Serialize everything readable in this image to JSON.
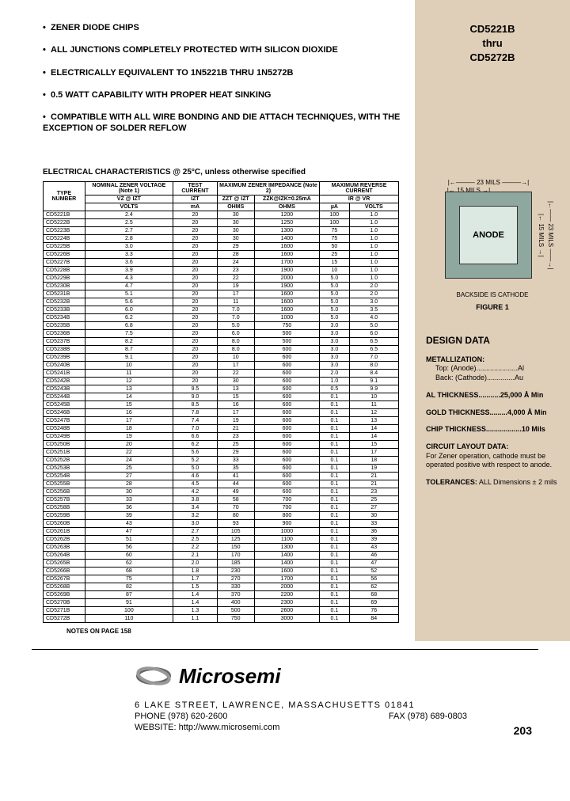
{
  "parts": {
    "top": "CD5221B",
    "mid": "thru",
    "bot": "CD5272B"
  },
  "bullets": [
    "ZENER DIODE CHIPS",
    "ALL JUNCTIONS COMPLETELY PROTECTED WITH SILICON DIOXIDE",
    "ELECTRICALLY EQUIVALENT TO 1N5221B THRU 1N5272B",
    "0.5 WATT CAPABILITY WITH PROPER HEAT SINKING",
    "COMPATIBLE WITH ALL WIRE BONDING AND DIE ATTACH TECHNIQUES, WITH THE EXCEPTION OF SOLDER REFLOW"
  ],
  "ec_title": "ELECTRICAL CHARACTERISTICS @ 25°C, unless otherwise specified",
  "headers": {
    "type": "TYPE NUMBER",
    "nominal": "NOMINAL ZENER VOLTAGE (Note 1)",
    "test": "TEST CURRENT",
    "maximp": "MAXIMUM ZENER IMPEDANCE (Note 2)",
    "maxrev": "MAXIMUM REVERSE CURRENT",
    "vz": "VZ @ IZT",
    "izt": "IZT",
    "zzt": "ZZT @ IZT",
    "zzk": "ZZK@IZK=0.25mA",
    "ir": "IR @ VR",
    "u_volts": "VOLTS",
    "u_ma": "mA",
    "u_ohms": "OHMS",
    "u_ua": "µA"
  },
  "notes_line": "NOTES ON PAGE 158",
  "chart_data": {
    "type": "table",
    "columns": [
      "TYPE",
      "VZ@IZT (V)",
      "IZT (mA)",
      "ZZT@IZT (Ω)",
      "ZZK@IZK=0.25mA (Ω)",
      "IR (µA)",
      "VR (V)"
    ],
    "rows": [
      [
        "CD5221B",
        "2.4",
        "20",
        "30",
        "1200",
        "100",
        "1.0"
      ],
      [
        "CD5222B",
        "2.5",
        "20",
        "30",
        "1250",
        "100",
        "1.0"
      ],
      [
        "CD5223B",
        "2.7",
        "20",
        "30",
        "1300",
        "75",
        "1.0"
      ],
      [
        "CD5224B",
        "2.8",
        "20",
        "30",
        "1400",
        "75",
        "1.0"
      ],
      [
        "CD5225B",
        "3.0",
        "20",
        "29",
        "1600",
        "50",
        "1.0"
      ],
      [
        "CD5226B",
        "3.3",
        "20",
        "28",
        "1600",
        "25",
        "1.0"
      ],
      [
        "CD5227B",
        "3.6",
        "20",
        "24",
        "1700",
        "15",
        "1.0"
      ],
      [
        "CD5228B",
        "3.9",
        "20",
        "23",
        "1900",
        "10",
        "1.0"
      ],
      [
        "CD5229B",
        "4.3",
        "20",
        "22",
        "2000",
        "5.0",
        "1.0"
      ],
      [
        "CD5230B",
        "4.7",
        "20",
        "19",
        "1900",
        "5.0",
        "2.0"
      ],
      [
        "CD5231B",
        "5.1",
        "20",
        "17",
        "1600",
        "5.0",
        "2.0"
      ],
      [
        "CD5232B",
        "5.6",
        "20",
        "11",
        "1600",
        "5.0",
        "3.0"
      ],
      [
        "CD5233B",
        "6.0",
        "20",
        "7.0",
        "1600",
        "5.0",
        "3.5"
      ],
      [
        "CD5234B",
        "6.2",
        "20",
        "7.0",
        "1000",
        "5.0",
        "4.0"
      ],
      [
        "CD5235B",
        "6.8",
        "20",
        "5.0",
        "750",
        "3.0",
        "5.0"
      ],
      [
        "CD5236B",
        "7.5",
        "20",
        "6.0",
        "500",
        "3.0",
        "6.0"
      ],
      [
        "CD5237B",
        "8.2",
        "20",
        "8.0",
        "500",
        "3.0",
        "6.5"
      ],
      [
        "CD5238B",
        "8.7",
        "20",
        "8.0",
        "600",
        "3.0",
        "6.5"
      ],
      [
        "CD5239B",
        "9.1",
        "20",
        "10",
        "600",
        "3.0",
        "7.0"
      ],
      [
        "CD5240B",
        "10",
        "20",
        "17",
        "600",
        "3.0",
        "8.0"
      ],
      [
        "CD5241B",
        "11",
        "20",
        "22",
        "600",
        "2.0",
        "8.4"
      ],
      [
        "CD5242B",
        "12",
        "20",
        "30",
        "600",
        "1.0",
        "9.1"
      ],
      [
        "CD5243B",
        "13",
        "9.5",
        "13",
        "600",
        "0.5",
        "9.9"
      ],
      [
        "CD5244B",
        "14",
        "9.0",
        "15",
        "600",
        "0.1",
        "10"
      ],
      [
        "CD5245B",
        "15",
        "8.5",
        "16",
        "600",
        "0.1",
        "11"
      ],
      [
        "CD5246B",
        "16",
        "7.8",
        "17",
        "600",
        "0.1",
        "12"
      ],
      [
        "CD5247B",
        "17",
        "7.4",
        "19",
        "600",
        "0.1",
        "13"
      ],
      [
        "CD5248B",
        "18",
        "7.0",
        "21",
        "600",
        "0.1",
        "14"
      ],
      [
        "CD5249B",
        "19",
        "6.6",
        "23",
        "600",
        "0.1",
        "14"
      ],
      [
        "CD5250B",
        "20",
        "6.2",
        "25",
        "600",
        "0.1",
        "15"
      ],
      [
        "CD5251B",
        "22",
        "5.6",
        "29",
        "600",
        "0.1",
        "17"
      ],
      [
        "CD5252B",
        "24",
        "5.2",
        "33",
        "600",
        "0.1",
        "18"
      ],
      [
        "CD5253B",
        "25",
        "5.0",
        "35",
        "600",
        "0.1",
        "19"
      ],
      [
        "CD5254B",
        "27",
        "4.6",
        "41",
        "600",
        "0.1",
        "21"
      ],
      [
        "CD5255B",
        "28",
        "4.5",
        "44",
        "600",
        "0.1",
        "21"
      ],
      [
        "CD5256B",
        "30",
        "4.2",
        "49",
        "600",
        "0.1",
        "23"
      ],
      [
        "CD5257B",
        "33",
        "3.8",
        "58",
        "700",
        "0.1",
        "25"
      ],
      [
        "CD5258B",
        "36",
        "3.4",
        "70",
        "700",
        "0.1",
        "27"
      ],
      [
        "CD5259B",
        "39",
        "3.2",
        "80",
        "800",
        "0.1",
        "30"
      ],
      [
        "CD5260B",
        "43",
        "3.0",
        "93",
        "900",
        "0.1",
        "33"
      ],
      [
        "CD5261B",
        "47",
        "2.7",
        "105",
        "1000",
        "0.1",
        "36"
      ],
      [
        "CD5262B",
        "51",
        "2.5",
        "125",
        "1100",
        "0.1",
        "39"
      ],
      [
        "CD5263B",
        "56",
        "2.2",
        "150",
        "1300",
        "0.1",
        "43"
      ],
      [
        "CD5264B",
        "60",
        "2.1",
        "170",
        "1400",
        "0.1",
        "46"
      ],
      [
        "CD5265B",
        "62",
        "2.0",
        "185",
        "1400",
        "0.1",
        "47"
      ],
      [
        "CD5266B",
        "68",
        "1.8",
        "230",
        "1600",
        "0.1",
        "52"
      ],
      [
        "CD5267B",
        "75",
        "1.7",
        "270",
        "1700",
        "0.1",
        "56"
      ],
      [
        "CD5268B",
        "82",
        "1.5",
        "330",
        "2000",
        "0.1",
        "62"
      ],
      [
        "CD5269B",
        "87",
        "1.4",
        "370",
        "2200",
        "0.1",
        "68"
      ],
      [
        "CD5270B",
        "91",
        "1.4",
        "400",
        "2300",
        "0.1",
        "69"
      ],
      [
        "CD5271B",
        "100",
        "1.3",
        "500",
        "2600",
        "0.1",
        "76"
      ],
      [
        "CD5272B",
        "110",
        "1.1",
        "750",
        "3000",
        "0.1",
        "84"
      ]
    ],
    "group_breaks": [
      5,
      10,
      15,
      20,
      25,
      30,
      35,
      40,
      45,
      50
    ]
  },
  "figure": {
    "dim23": "23 MILS",
    "dim15": "15 MILS",
    "anode": "ANODE",
    "backside": "BACKSIDE IS CATHODE",
    "label": "FIGURE 1"
  },
  "design_data": {
    "title": "DESIGN DATA",
    "metallization_label": "METALLIZATION:",
    "metal_top": "Top: (Anode).....................Al",
    "metal_back": "Back: (Cathode)..............Au",
    "al_thick": "AL THICKNESS...........25,000 Å Min",
    "gold_thick": "GOLD THICKNESS.........4,000 Å Min",
    "chip_thick": "CHIP THICKNESS..................10 Mils",
    "circuit_label": "CIRCUIT LAYOUT DATA:",
    "circuit_text": "For Zener operation, cathode must be operated positive with respect to anode.",
    "tol_label": "TOLERANCES:",
    "tol_text": "ALL Dimensions ± 2 mils"
  },
  "footer": {
    "company": "Microsemi",
    "addr1": "6 LAKE STREET, LAWRENCE, MASSACHUSETTS 01841",
    "phone": "PHONE (978) 620-2600",
    "fax": "FAX (978) 689-0803",
    "web": "WEBSITE: http://www.microsemi.com",
    "page": "203"
  }
}
